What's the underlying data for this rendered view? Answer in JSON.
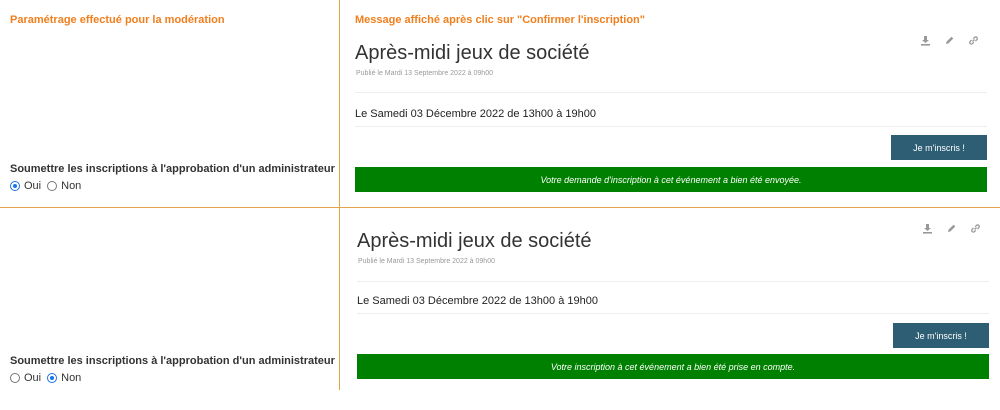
{
  "left_header": "Paramétrage effectué pour la modération",
  "right_header": "Message affiché après clic sur \"Confirmer l'inscription\"",
  "moderation_question": "Soumettre les inscriptions à l'approbation d'un administrateur",
  "option_yes": "Oui",
  "option_no": "Non",
  "panel1": {
    "title": "Après-midi jeux de société",
    "published": "Publié le Mardi 13 Septembre 2022 à 09h00",
    "date": "Le Samedi 03 Décembre 2022 de 13h00 à 19h00",
    "button": "Je m'inscris !",
    "message": "Votre demande d'inscription à cet événement a bien été envoyée.",
    "selected": "Oui"
  },
  "panel2": {
    "title": "Après-midi jeux de société",
    "published": "Publié le Mardi 13 Septembre 2022 à 09h00",
    "date": "Le Samedi 03 Décembre 2022 de 13h00 à 19h00",
    "button": "Je m'inscris !",
    "message": "Votre inscription à cet événement a bien été prise en compte.",
    "selected": "Non"
  },
  "icons": [
    "download-icon",
    "pencil-icon",
    "link-icon"
  ],
  "colors": {
    "header": "#f07f1e",
    "divider": "#e3a44a",
    "button": "#2e5e74",
    "success": "#008000",
    "radio": "#1a73e8"
  }
}
